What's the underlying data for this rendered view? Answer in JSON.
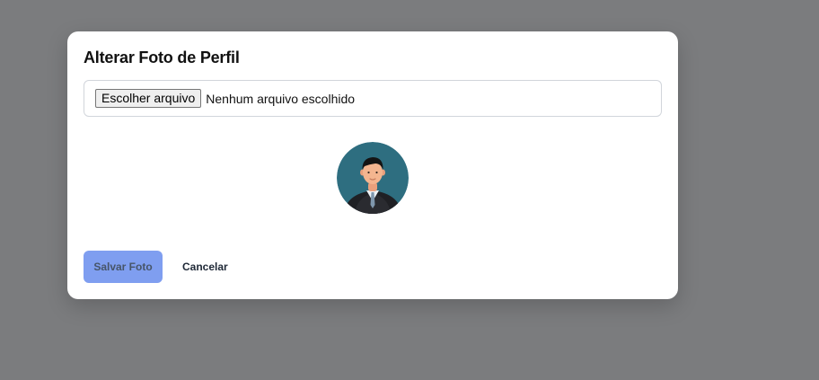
{
  "modal": {
    "title": "Alterar Foto de Perfil",
    "file_input": {
      "button_label": "Escolher arquivo",
      "status_text": "Nenhum arquivo escolhido"
    },
    "avatar": {
      "icon": "user-avatar-icon",
      "background_color": "#2e6e80"
    },
    "actions": {
      "save_label": "Salvar Foto",
      "cancel_label": "Cancelar"
    }
  },
  "colors": {
    "overlay": "#7b7c7e",
    "save_button": "#7f9ef0",
    "modal_background": "#ffffff"
  }
}
